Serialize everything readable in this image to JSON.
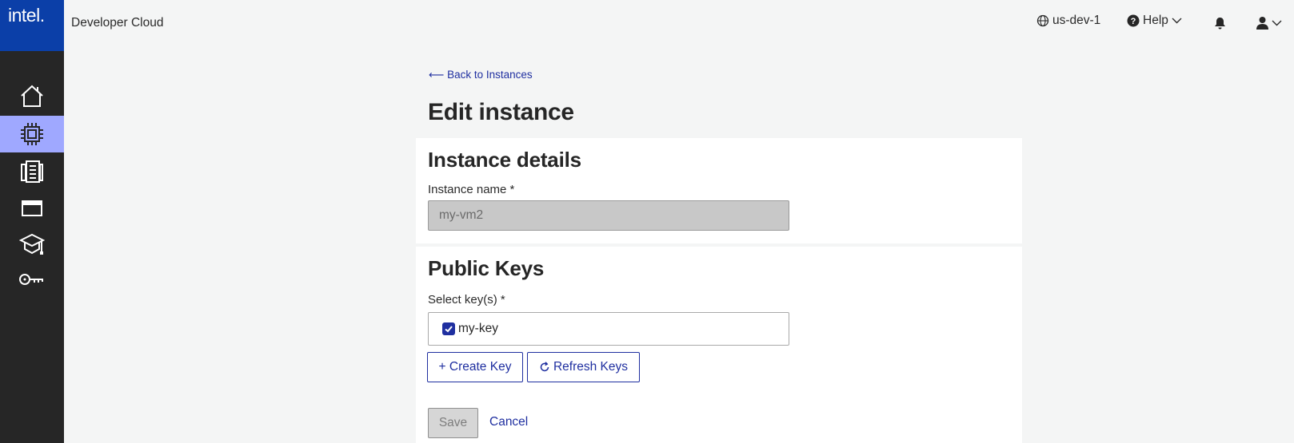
{
  "brand": {
    "logo_text": "intel.",
    "app_title": "Developer Cloud"
  },
  "topbar": {
    "region": "us-dev-1",
    "help_label": "Help"
  },
  "sidebar": {
    "items": [
      {
        "name": "home",
        "active": false
      },
      {
        "name": "compute",
        "active": true
      },
      {
        "name": "storage",
        "active": false
      },
      {
        "name": "console",
        "active": false
      },
      {
        "name": "learning",
        "active": false
      },
      {
        "name": "keys",
        "active": false
      }
    ]
  },
  "page": {
    "back_link": "⟵ Back to Instances",
    "title": "Edit instance"
  },
  "instance_details": {
    "heading": "Instance details",
    "name_label": "Instance name *",
    "name_value": "my-vm2"
  },
  "public_keys": {
    "heading": "Public Keys",
    "select_label": "Select key(s) *",
    "keys": [
      {
        "label": "my-key",
        "checked": true
      }
    ],
    "create_key_label": "+ Create Key",
    "refresh_keys_label": "Refresh Keys"
  },
  "actions": {
    "save_label": "Save",
    "cancel_label": "Cancel"
  },
  "colors": {
    "brand_blue": "#0b3fa8",
    "accent": "#1f2fa0",
    "active_rail": "#9fa8ff",
    "rail_bg": "#262626",
    "page_bg": "#f4f5f5"
  }
}
